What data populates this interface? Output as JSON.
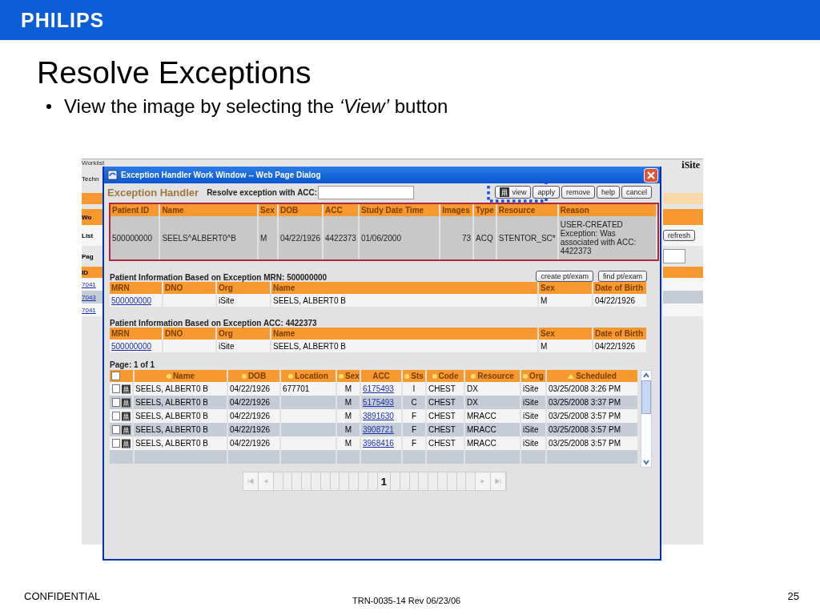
{
  "logo": "PHILIPS",
  "title": "Resolve Exceptions",
  "bullets": [
    "View the image by selecting the *‘View’* button"
  ],
  "app": {
    "nav": "Worklist",
    "brand": "iSite",
    "side": [
      "Techn",
      "Wo",
      "List",
      "Pag"
    ],
    "id_header": "ID",
    "id_links": [
      "7041",
      "7043",
      "7041"
    ],
    "refresh": "refresh"
  },
  "dialog": {
    "title": "Exception Handler Work Window -- Web Page Dialog",
    "heading": "Exception Handler",
    "acc_label": "Resolve exception with ACC:",
    "buttons": [
      {
        "label": "view",
        "icon": true,
        "highlighted": true
      },
      {
        "label": "apply",
        "icon": false,
        "highlighted": false
      },
      {
        "label": "remove",
        "icon": false,
        "highlighted": false
      },
      {
        "label": "help",
        "icon": false,
        "highlighted": false
      },
      {
        "label": "cancel",
        "icon": false,
        "highlighted": false
      }
    ],
    "exception": {
      "columns": [
        "Patient ID",
        "Name",
        "Sex",
        "DOB",
        "ACC",
        "Study Date Time",
        "Images",
        "Type",
        "Resource",
        "Reason"
      ],
      "row": [
        "500000000",
        "SEELS^ALBERT0^B",
        "M",
        "04/22/1926",
        "4422373",
        "01/06/2000",
        "73",
        "ACQ",
        "STENTOR_SC*",
        "USER-CREATED Exception: Was associated with ACC: 4422373"
      ]
    },
    "sections": [
      {
        "title": "Patient Information Based on Exception MRN: 500000000",
        "buttons": [
          "create pt/exam",
          "find pt/exam"
        ],
        "columns": [
          "MRN",
          "DNO",
          "Org",
          "Name",
          "Sex",
          "Date of Birth"
        ],
        "rows": [
          {
            "mrn": "500000000",
            "org": "iSite",
            "name": "SEELS, ALBERT0 B",
            "sex": "M",
            "dob": "04/22/1926"
          }
        ]
      },
      {
        "title": "Patient Information Based on Exception ACC: 4422373",
        "columns": [
          "MRN",
          "DNO",
          "Org",
          "Name",
          "Sex",
          "Date of Birth"
        ],
        "rows": [
          {
            "mrn": "500000000",
            "org": "iSite",
            "name": "SEELS, ALBERT0 B",
            "sex": "M",
            "dob": "04/22/1926"
          }
        ]
      }
    ],
    "exams": {
      "page": "Page: 1 of 1",
      "select_all": false,
      "columns": [
        {
          "label": "Name",
          "sortable": true,
          "sorted": false
        },
        {
          "label": "DOB",
          "sortable": true,
          "sorted": false
        },
        {
          "label": "Location",
          "sortable": true,
          "sorted": false
        },
        {
          "label": "Sex",
          "sortable": true,
          "sorted": false
        },
        {
          "label": "ACC",
          "sortable": false,
          "sorted": false
        },
        {
          "label": "Sts",
          "sortable": true,
          "sorted": false
        },
        {
          "label": "Code",
          "sortable": true,
          "sorted": false
        },
        {
          "label": "Resource",
          "sortable": true,
          "sorted": false
        },
        {
          "label": "Org",
          "sortable": true,
          "sorted": false
        },
        {
          "label": "Scheduled",
          "sortable": true,
          "sorted": true
        }
      ],
      "rows": [
        {
          "checked": false,
          "name": "SEELS, ALBERT0 B",
          "dob": "04/22/1926",
          "location": "677701",
          "sex": "M",
          "acc": "6175493",
          "sts": "I",
          "code": "CHEST",
          "resource": "DX",
          "org": "iSite",
          "scheduled": "03/25/2008 3:26 PM"
        },
        {
          "checked": false,
          "name": "SEELS, ALBERT0 B",
          "dob": "04/22/1926",
          "sex": "M",
          "acc": "5175493",
          "sts": "C",
          "code": "CHEST",
          "resource": "DX",
          "org": "iSite",
          "scheduled": "03/25/2008 3:37 PM"
        },
        {
          "checked": false,
          "name": "SEELS, ALBERT0 B",
          "dob": "04/22/1926",
          "sex": "M",
          "acc": "3891630",
          "sts": "F",
          "code": "CHEST",
          "resource": "MRACC",
          "org": "iSite",
          "scheduled": "03/25/2008 3:57 PM"
        },
        {
          "checked": false,
          "name": "SEELS, ALBERT0 B",
          "dob": "04/22/1926",
          "sex": "M",
          "acc": "3908721",
          "sts": "F",
          "code": "CHEST",
          "resource": "MRACC",
          "org": "iSite",
          "scheduled": "03/25/2008 3:57 PM"
        },
        {
          "checked": false,
          "name": "SEELS, ALBERT0 B",
          "dob": "04/22/1926",
          "sex": "M",
          "acc": "3968416",
          "sts": "F",
          "code": "CHEST",
          "resource": "MRACC",
          "org": "iSite",
          "scheduled": "03/25/2008 3:57 PM"
        }
      ]
    },
    "pager": {
      "current": "1"
    }
  },
  "footer": {
    "left": "CONFIDENTIAL",
    "center": "TRN-0035-14 Rev 06/23/06",
    "page": "25"
  }
}
